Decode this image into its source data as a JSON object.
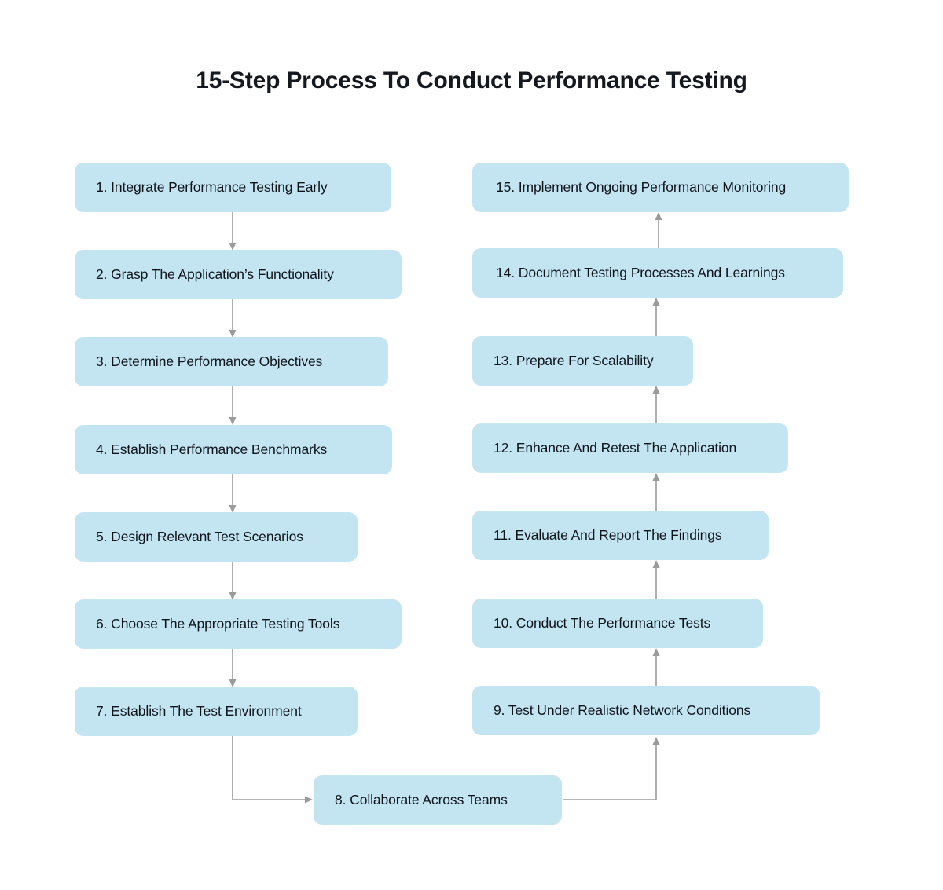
{
  "page": {
    "title": "15-Step Process To Conduct Performance Testing",
    "background_color": "#ffffff",
    "node_fill_color": "#c3e5f2",
    "node_text_color": "#10151c",
    "connector_color": "#9b9b9b"
  },
  "diagram": {
    "type": "flowchart",
    "orientation": "two-column-serpentine",
    "left_column_flow": "top-to-bottom",
    "right_column_flow": "bottom-to-top",
    "steps": [
      {
        "number": "1.",
        "label": "Integrate Performance Testing Early",
        "full": "1. Integrate Performance Testing Early",
        "column": "left"
      },
      {
        "number": "2.",
        "label": "Grasp The Application’s Functionality",
        "full": "2. Grasp The Application’s Functionality",
        "column": "left"
      },
      {
        "number": "3.",
        "label": "Determine Performance Objectives",
        "full": "3.  Determine Performance Objectives",
        "column": "left"
      },
      {
        "number": "4.",
        "label": "Establish Performance Benchmarks",
        "full": "4.  Establish Performance Benchmarks",
        "column": "left"
      },
      {
        "number": "5.",
        "label": "Design Relevant Test Scenarios",
        "full": "5. Design Relevant Test Scenarios",
        "column": "left"
      },
      {
        "number": "6.",
        "label": "Choose The Appropriate Testing Tools",
        "full": "6. Choose The Appropriate Testing Tools",
        "column": "left"
      },
      {
        "number": "7.",
        "label": "Establish The Test Environment",
        "full": "7. Establish The Test Environment",
        "column": "left"
      },
      {
        "number": "8.",
        "label": "Collaborate Across Teams",
        "full": "8. Collaborate Across Teams",
        "column": "center"
      },
      {
        "number": "9.",
        "label": "Test Under Realistic Network Conditions",
        "full": "9. Test Under Realistic Network Conditions",
        "column": "right"
      },
      {
        "number": "10.",
        "label": "Conduct The Performance Tests",
        "full": "10. Conduct The Performance Tests",
        "column": "right"
      },
      {
        "number": "11.",
        "label": "Evaluate And Report The Findings",
        "full": "11. Evaluate And Report The Findings",
        "column": "right"
      },
      {
        "number": "12.",
        "label": "Enhance And Retest The Application",
        "full": "12. Enhance And Retest The Application",
        "column": "right"
      },
      {
        "number": "13.",
        "label": "Prepare For Scalability",
        "full": "13. Prepare For Scalability",
        "column": "right"
      },
      {
        "number": "14.",
        "label": "Document Testing Processes And Learnings",
        "full": "14.  Document Testing Processes And Learnings",
        "column": "right"
      },
      {
        "number": "15.",
        "label": "Implement Ongoing Performance Monitoring",
        "full": "15.  Implement Ongoing Performance Monitoring",
        "column": "right"
      }
    ]
  }
}
